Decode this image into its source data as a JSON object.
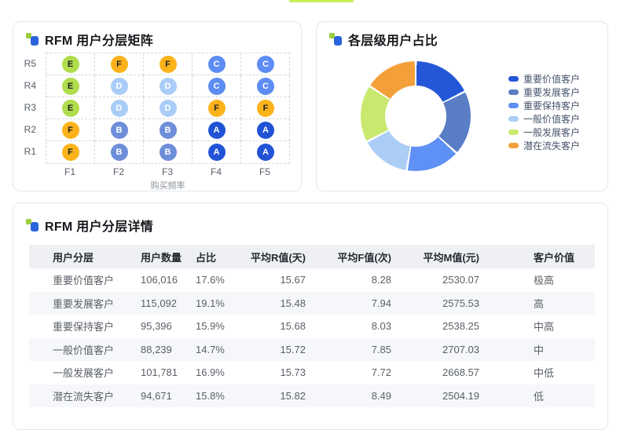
{
  "accent_bar_color": "#c4ee58",
  "cards": {
    "matrix_title": "RFM 用户分层矩阵",
    "donut_title": "各层级用户占比",
    "table_title": "RFM 用户分层详情"
  },
  "chart_data": [
    {
      "type": "heatmap",
      "title": "RFM 用户分层矩阵",
      "xlabel": "购买频率",
      "x_ticks": [
        "F1",
        "F2",
        "F3",
        "F4",
        "F5"
      ],
      "y_ticks": [
        "R5",
        "R4",
        "R3",
        "R2",
        "R1"
      ],
      "cells": [
        [
          "E",
          "F",
          "F",
          "C",
          "C"
        ],
        [
          "E",
          "D",
          "D",
          "C",
          "C"
        ],
        [
          "E",
          "D",
          "D",
          "F",
          "F"
        ],
        [
          "F",
          "B",
          "B",
          "A",
          "A"
        ],
        [
          "F",
          "B",
          "B",
          "A",
          "A"
        ]
      ],
      "tier_styles": {
        "A": {
          "bg": "#2253d6",
          "fg": "#ffffff"
        },
        "B": {
          "bg": "#6e8ed9",
          "fg": "#ffffff"
        },
        "C": {
          "bg": "#5c8cf4",
          "fg": "#ffffff"
        },
        "D": {
          "bg": "#aacdf8",
          "fg": "#ffffff"
        },
        "E": {
          "bg": "#b0dd4d",
          "fg": "#222222"
        },
        "F": {
          "bg": "#fcb31b",
          "fg": "#222222"
        }
      },
      "grid": true
    },
    {
      "type": "pie",
      "title": "各层级用户占比",
      "legend_position": "right",
      "labels": [
        "重要价值客户",
        "重要发展客户",
        "重要保持客户",
        "一般价值客户",
        "一般发展客户",
        "潜在流失客户"
      ],
      "values": [
        17.6,
        19.1,
        15.9,
        14.7,
        16.9,
        15.8
      ],
      "colors": [
        "#2457d8",
        "#5a7ec5",
        "#5e90f5",
        "#abcdf6",
        "#c9e96e",
        "#f4a03a"
      ],
      "inner_radius_ratio": 0.56,
      "start_angle_deg": 0,
      "direction": "clockwise"
    },
    {
      "type": "table",
      "title": "RFM 用户分层详情",
      "columns": [
        "用户分层",
        "用户数量",
        "占比",
        "平均R值(天)",
        "平均F值(次)",
        "平均M值(元)",
        "客户价值"
      ],
      "rows": [
        [
          "重要价值客户",
          "106,016",
          "17.6%",
          "15.67",
          "8.28",
          "2530.07",
          "极高"
        ],
        [
          "重要发展客户",
          "115,092",
          "19.1%",
          "15.48",
          "7.94",
          "2575.53",
          "高"
        ],
        [
          "重要保持客户",
          "95,396",
          "15.9%",
          "15.68",
          "8.03",
          "2538.25",
          "中高"
        ],
        [
          "一般价值客户",
          "88,239",
          "14.7%",
          "15.72",
          "7.85",
          "2707.03",
          "中"
        ],
        [
          "一般发展客户",
          "101,781",
          "16.9%",
          "15.73",
          "7.72",
          "2668.57",
          "中低"
        ],
        [
          "潜在流失客户",
          "94,671",
          "15.8%",
          "15.82",
          "8.49",
          "2504.19",
          "低"
        ]
      ]
    }
  ]
}
